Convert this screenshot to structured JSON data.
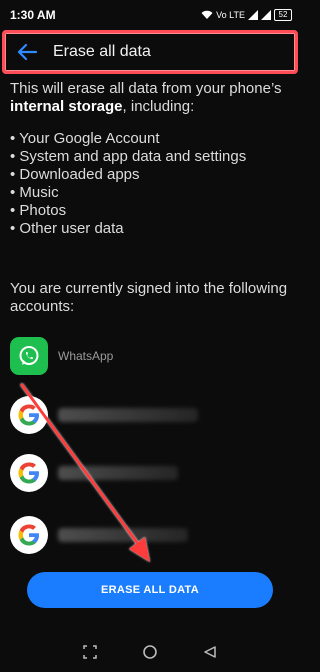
{
  "status_bar": {
    "time": "1:30 AM",
    "net": "Vo LTE",
    "battery": "52"
  },
  "header": {
    "title": "Erase all data"
  },
  "intro": {
    "text_before": "This will erase all data from your phone’s ",
    "bold": "internal storage",
    "text_after": ", including:"
  },
  "items": [
    "• Your Google Account",
    "• System and app data and settings",
    "• Downloaded apps",
    "• Music",
    "• Photos",
    "• Other user data"
  ],
  "accounts_title": "You are currently signed into the following accounts:",
  "accounts": [
    {
      "label": "WhatsApp",
      "icon": "whatsapp-icon"
    },
    {
      "label": "",
      "icon": "google-icon"
    },
    {
      "label": "",
      "icon": "google-icon"
    },
    {
      "label": "",
      "icon": "google-icon"
    }
  ],
  "erase_button": "ERASE ALL DATA",
  "colors": {
    "accent": "#1a7dff",
    "highlight": "#ff4d58",
    "whatsapp": "#1fbf4f"
  }
}
